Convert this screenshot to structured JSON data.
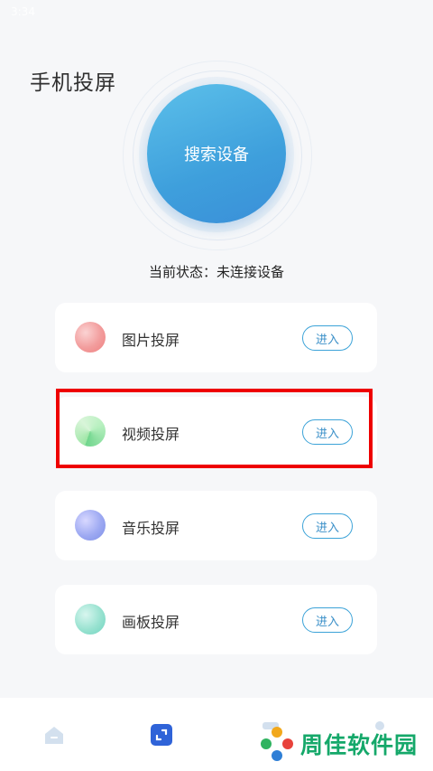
{
  "status_bar": {
    "time": "3:34"
  },
  "header": {
    "title": "手机投屏"
  },
  "search": {
    "label": "搜索设备"
  },
  "status": {
    "prefix": "当前状态：",
    "value": "未连接设备"
  },
  "features": [
    {
      "label": "图片投屏",
      "button": "进入",
      "icon": "pink-circle-icon"
    },
    {
      "label": "视频投屏",
      "button": "进入",
      "icon": "green-circle-icon"
    },
    {
      "label": "音乐投屏",
      "button": "进入",
      "icon": "blue-circle-icon"
    },
    {
      "label": "画板投屏",
      "button": "进入",
      "icon": "teal-circle-icon"
    }
  ],
  "bottom_nav": {
    "items": [
      "home-icon",
      "cast-icon",
      "tab-icon",
      "profile-icon"
    ],
    "active_index": 1
  },
  "watermark": {
    "text": "周佳软件园"
  },
  "colors": {
    "accent": "#3e9fdc",
    "highlight": "#ee0000",
    "brand_green": "#15a86a"
  }
}
